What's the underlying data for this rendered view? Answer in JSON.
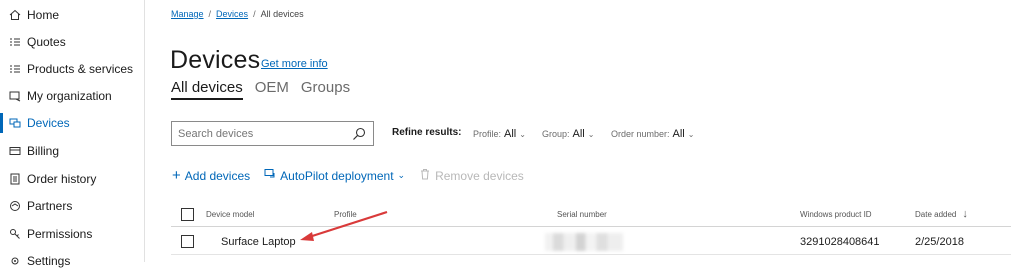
{
  "sidebar": {
    "items": [
      {
        "label": "Home",
        "icon": "home-icon"
      },
      {
        "label": "Quotes",
        "icon": "list-icon"
      },
      {
        "label": "Products & services",
        "icon": "list-icon"
      },
      {
        "label": "My organization",
        "icon": "organization-icon"
      },
      {
        "label": "Devices",
        "icon": "devices-icon",
        "active": true
      },
      {
        "label": "Billing",
        "icon": "billing-icon"
      },
      {
        "label": "Order history",
        "icon": "order-history-icon"
      },
      {
        "label": "Partners",
        "icon": "partners-icon"
      },
      {
        "label": "Permissions",
        "icon": "permissions-icon"
      },
      {
        "label": "Settings",
        "icon": "settings-icon"
      }
    ]
  },
  "breadcrumb": {
    "items": [
      "Manage",
      "Devices",
      "All devices"
    ],
    "separator": "/"
  },
  "header": {
    "title": "Devices",
    "more_info": "Get more info"
  },
  "tabs": [
    "All devices",
    "OEM",
    "Groups"
  ],
  "search": {
    "placeholder": "Search devices",
    "value": ""
  },
  "refine": {
    "label": "Refine results:",
    "filters": [
      {
        "label": "Profile:",
        "value": "All"
      },
      {
        "label": "Group:",
        "value": "All"
      },
      {
        "label": "Order number:",
        "value": "All"
      }
    ]
  },
  "commands": {
    "add": "Add devices",
    "autopilot": "AutoPilot deployment",
    "remove": "Remove devices"
  },
  "table": {
    "columns": [
      "Device model",
      "Profile",
      "Serial number",
      "Windows product ID",
      "Date added"
    ],
    "sort_indicator": "↓",
    "rows": [
      {
        "device_model": "Surface Laptop",
        "profile": "",
        "serial_number": "",
        "windows_product_id": "3291028408641",
        "date_added": "2/25/2018"
      }
    ]
  },
  "colors": {
    "accent": "#0067b8",
    "annotation_arrow": "#d93a3a"
  }
}
